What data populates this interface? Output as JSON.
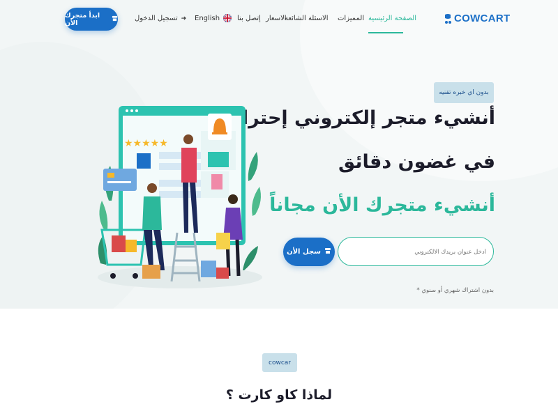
{
  "brand": {
    "name": "COWCART"
  },
  "nav": {
    "items": [
      {
        "label": "الصفحة الرئيسية",
        "active": true
      },
      {
        "label": "المميزات"
      },
      {
        "label": "الاسئلة الشائعة"
      },
      {
        "label": "الاسعار"
      },
      {
        "label": "إتصل بنا"
      }
    ],
    "language": "English",
    "login": "تسجيل الدخول",
    "cta": "ابدأ متجرك الأن"
  },
  "hero": {
    "badge": "بدون اي خبره تقنيه",
    "line1": "أنشيء متجر إلكتروني إحترافي",
    "line2": "في غضون دقائق",
    "line3": "أنشيء متجرك الأن مجاناً",
    "email_placeholder": "أدخل عنوان بريدك الالكتروني",
    "signup": "سجل الأن",
    "note": "بدون اشتراك شهري أو سنوي *"
  },
  "why": {
    "pill": "cowcar",
    "title": "لماذا كاو كارت ؟"
  },
  "colors": {
    "primary": "#1b6fc7",
    "accent": "#2cb89b",
    "hero_bg": "#f2f6f6"
  },
  "icons": [
    "cowcart-logo-icon",
    "uk-flag-icon",
    "login-icon",
    "store-icon",
    "ecommerce-illustration"
  ]
}
